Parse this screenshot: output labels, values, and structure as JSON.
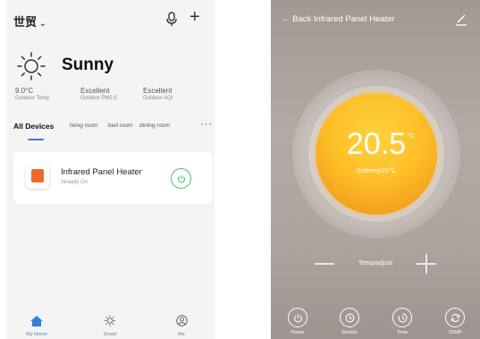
{
  "home": {
    "location": "世贸",
    "weather": {
      "condition": "Sunny",
      "stats": [
        {
          "value": "9.0°C",
          "label": "Outdoor Temp"
        },
        {
          "value": "Excellent",
          "label": "Outdoor PM2.5"
        },
        {
          "value": "Excellent",
          "label": "Outdoor AQI"
        }
      ]
    },
    "tabs": [
      "All Devices",
      "living room",
      "bed room",
      "dining room"
    ],
    "more": "···",
    "device": {
      "name": "Infrared Panel Heater",
      "status": "Already On"
    },
    "nav": [
      {
        "label": "My Home",
        "icon": "home-icon"
      },
      {
        "label": "Smart",
        "icon": "sun-icon"
      },
      {
        "label": "Me",
        "icon": "user-icon"
      }
    ],
    "accent": "#3a7fd5",
    "power_on_color": "#4cc36b"
  },
  "detail": {
    "back_title": "← Back  Infrared Panel Heater",
    "temperature": "20.5",
    "unit": "°C",
    "set_temp": "Settemp21℃",
    "adjust_label": "Tempadjust",
    "controls": [
      {
        "label": "Power",
        "icon": "power-icon"
      },
      {
        "label": "Weekly",
        "icon": "clock-icon"
      },
      {
        "label": "Time",
        "icon": "timer-icon"
      },
      {
        "label": "TEMP",
        "icon": "refresh-icon"
      }
    ]
  }
}
